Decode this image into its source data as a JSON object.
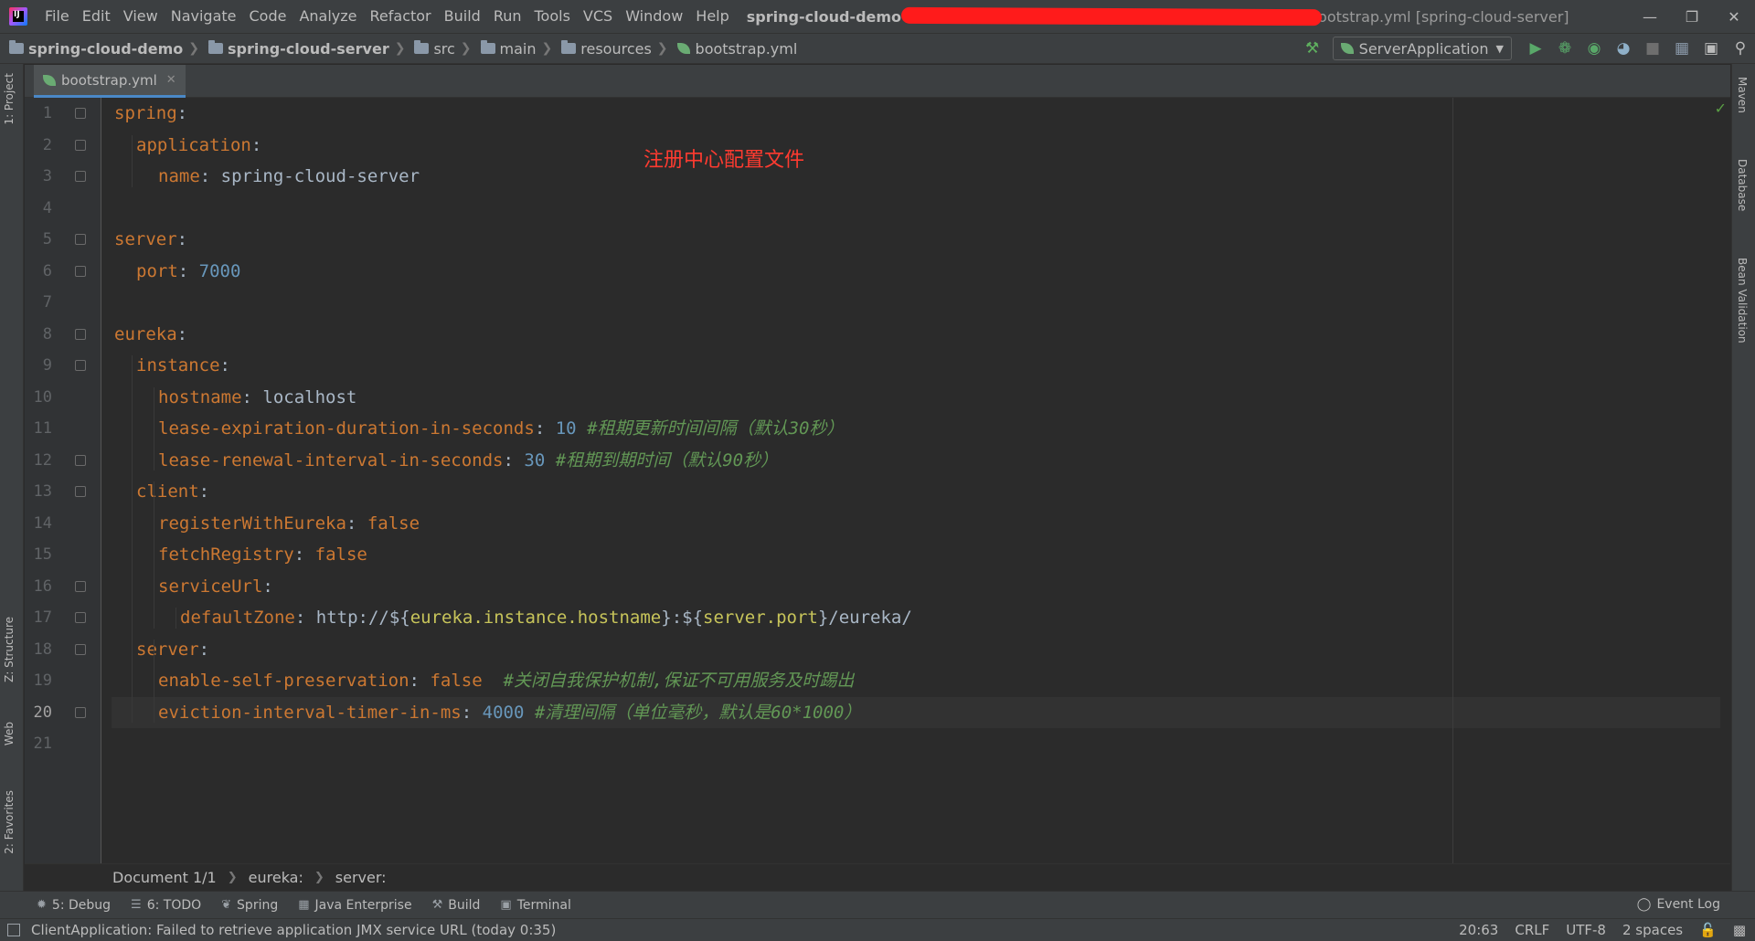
{
  "menubar": {
    "items": [
      "File",
      "Edit",
      "View",
      "Navigate",
      "Code",
      "Analyze",
      "Refactor",
      "Build",
      "Run",
      "Tools",
      "VCS",
      "Window",
      "Help"
    ],
    "title_project": "spring-cloud-demo",
    "title_file": "ootstrap.yml [spring-cloud-server]"
  },
  "navbar": {
    "crumbs": [
      "spring-cloud-demo",
      "spring-cloud-server",
      "src",
      "main",
      "resources",
      "bootstrap.yml"
    ],
    "run_config": "ServerApplication"
  },
  "left_tabs": [
    "1: Project",
    "Z: Structure",
    "Web",
    "2: Favorites"
  ],
  "right_tabs": [
    "Maven",
    "Database",
    "Bean Validation"
  ],
  "editor": {
    "tab_label": "bootstrap.yml",
    "annotation": "注册中心配置文件",
    "current_line": 20,
    "lines": [
      {
        "n": "1",
        "indent": 0,
        "key": "spring",
        "value": "",
        "comment": ""
      },
      {
        "n": "2",
        "indent": 1,
        "key": "application",
        "value": "",
        "comment": ""
      },
      {
        "n": "3",
        "indent": 2,
        "key": "name",
        "value": "spring-cloud-server",
        "comment": ""
      },
      {
        "n": "4",
        "indent": 0,
        "key": "",
        "value": "",
        "comment": ""
      },
      {
        "n": "5",
        "indent": 0,
        "key": "server",
        "value": "",
        "comment": ""
      },
      {
        "n": "6",
        "indent": 1,
        "key": "port",
        "num": "7000",
        "comment": ""
      },
      {
        "n": "7",
        "indent": 0,
        "key": "",
        "value": "",
        "comment": ""
      },
      {
        "n": "8",
        "indent": 0,
        "key": "eureka",
        "value": "",
        "comment": ""
      },
      {
        "n": "9",
        "indent": 1,
        "key": "instance",
        "value": "",
        "comment": ""
      },
      {
        "n": "10",
        "indent": 2,
        "key": "hostname",
        "value": "localhost",
        "comment": ""
      },
      {
        "n": "11",
        "indent": 2,
        "key": "lease-expiration-duration-in-seconds",
        "num": "10",
        "comment": "#租期更新时间间隔（默认30秒）"
      },
      {
        "n": "12",
        "indent": 2,
        "key": "lease-renewal-interval-in-seconds",
        "num": "30",
        "comment": "#租期到期时间（默认90秒）"
      },
      {
        "n": "13",
        "indent": 1,
        "key": "client",
        "value": "",
        "comment": ""
      },
      {
        "n": "14",
        "indent": 2,
        "key": "registerWithEureka",
        "kw": "false",
        "comment": ""
      },
      {
        "n": "15",
        "indent": 2,
        "key": "fetchRegistry",
        "kw": "false",
        "comment": ""
      },
      {
        "n": "16",
        "indent": 2,
        "key": "serviceUrl",
        "value": "",
        "comment": ""
      },
      {
        "n": "17",
        "indent": 3,
        "key": "defaultZone",
        "url_prefix": "http://${",
        "url_ref1": "eureka.instance.hostname",
        "url_mid": "}:${",
        "url_ref2": "server.port",
        "url_suffix": "}/eureka/",
        "comment": ""
      },
      {
        "n": "18",
        "indent": 1,
        "key": "server",
        "value": "",
        "comment": ""
      },
      {
        "n": "19",
        "indent": 2,
        "key": "enable-self-preservation",
        "kw": "false",
        "comment": "#关闭自我保护机制,保证不可用服务及时踢出"
      },
      {
        "n": "20",
        "indent": 2,
        "key": "eviction-interval-timer-in-ms",
        "num": "4000",
        "comment": "#清理间隔（单位毫秒，默认是60*1000）"
      },
      {
        "n": "21",
        "indent": 0,
        "key": "",
        "value": "",
        "comment": ""
      }
    ]
  },
  "structure_bar": [
    "Document 1/1",
    "eureka:",
    "server:"
  ],
  "tool_windows": [
    {
      "icon": "debug-icon",
      "label": "5: Debug"
    },
    {
      "icon": "todo-icon",
      "label": "6: TODO"
    },
    {
      "icon": "spring-icon",
      "label": "Spring"
    },
    {
      "icon": "java-enterprise-icon",
      "label": "Java Enterprise"
    },
    {
      "icon": "build-icon",
      "label": "Build"
    },
    {
      "icon": "terminal-icon",
      "label": "Terminal"
    }
  ],
  "event_log": "Event Log",
  "status": {
    "message": "ClientApplication: Failed to retrieve application JMX service URL (today 0:35)",
    "position": "20:63",
    "line_sep": "CRLF",
    "encoding": "UTF-8",
    "indent": "2 spaces"
  },
  "colors": {
    "key": "#cc7832",
    "number": "#6897bb",
    "comment": "#629755",
    "annotation": "#ff3b30",
    "redaction": "#ff1b1b"
  }
}
